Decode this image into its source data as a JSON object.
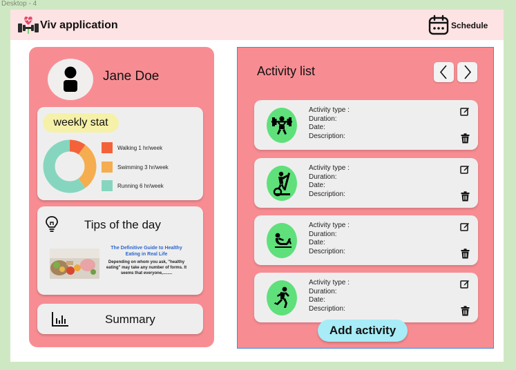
{
  "frame_label": "Desktop - 4",
  "header": {
    "app_title": "Viv application",
    "schedule_label": "Schedule"
  },
  "profile": {
    "name": "Jane Doe"
  },
  "weekly_stat": {
    "title": "weekly stat",
    "items": [
      {
        "label": "Walking 1 hr/week",
        "hours": 1,
        "color": "#f4623a"
      },
      {
        "label": "Swimming 3 hr/week",
        "hours": 3,
        "color": "#f5ad4f"
      },
      {
        "label": "Running 6 hr/week",
        "hours": 6,
        "color": "#86d6bf"
      }
    ]
  },
  "tips": {
    "title": "Tips of the day",
    "article_title": "The Definitive Guide to Healthy Eating in Real Life",
    "article_excerpt": "Depending on whom you ask, \"healthy eating\" may take any number of forms. It seems that everyone,........"
  },
  "summary": {
    "label": "Summary"
  },
  "activity_list": {
    "title": "Activity list",
    "field_labels": {
      "type": "Activity type :",
      "duration": "Duration:",
      "date": "Date:",
      "description": "Description:"
    },
    "activities": [
      {
        "icon": "weightlifting-icon"
      },
      {
        "icon": "elliptical-icon"
      },
      {
        "icon": "situp-icon"
      },
      {
        "icon": "running-icon"
      }
    ],
    "add_button": "Add activity"
  },
  "colors": {
    "background": "#cfe8c4",
    "header": "#fde3e3",
    "panel": "#f78d93",
    "card": "#efeeee",
    "chip": "#f6f1a8",
    "activity_icon_bg": "#5fe07b",
    "add_button": "#a7ecf6",
    "selection_outline": "#4a85d6"
  }
}
